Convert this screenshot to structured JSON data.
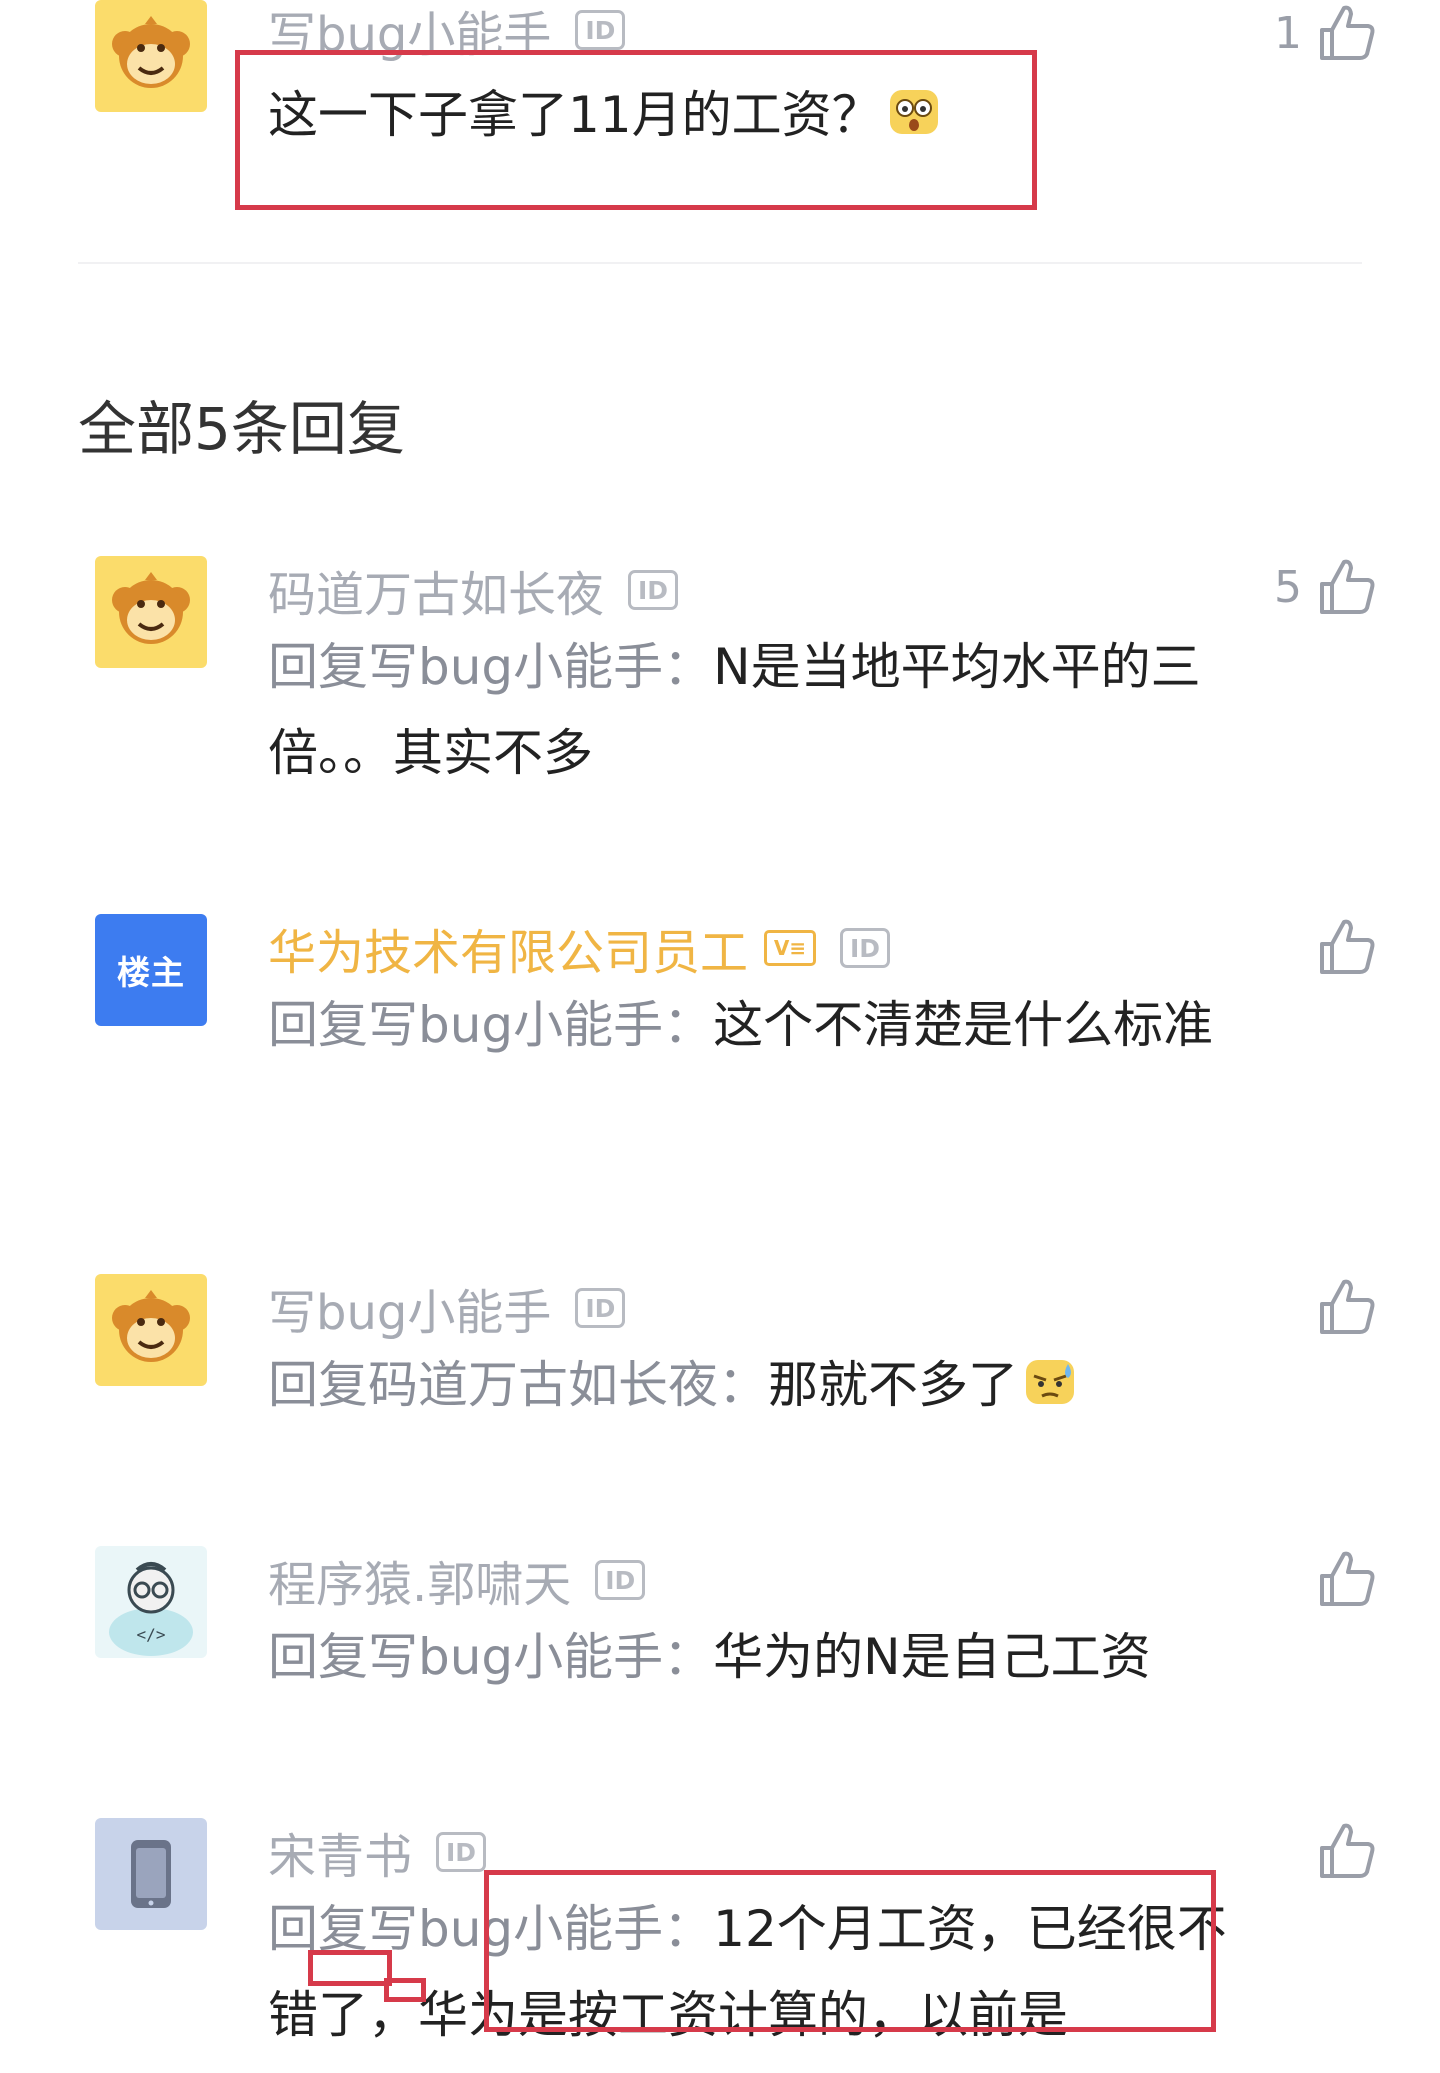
{
  "top_comment": {
    "username": "写bug小能手",
    "id_badge": "ID",
    "text": "这一下子拿了11月的工资？",
    "emoji": "shocked-face-emoji",
    "likes": "1"
  },
  "replies_header": "全部5条回复",
  "replies": [
    {
      "username": "码道万古如长夜",
      "id_badge": "ID",
      "prefix": "回复写bug小能手：",
      "text": "N是当地平均水平的三倍。。其实不多",
      "likes": "5"
    },
    {
      "avatar_label": "楼主",
      "username": "华为技术有限公司员工",
      "v_badge": "V≡",
      "id_badge": "ID",
      "prefix": "回复写bug小能手：",
      "text": "这个不清楚是什么标准",
      "likes": ""
    },
    {
      "username": "写bug小能手",
      "id_badge": "ID",
      "prefix": "回复码道万古如长夜：",
      "text": "那就不多了",
      "emoji": "sweat-face-emoji",
      "likes": ""
    },
    {
      "username": "程序猿.郭啸天",
      "id_badge": "ID",
      "prefix": "回复写bug小能手：",
      "text": "华为的N是自己工资",
      "likes": ""
    },
    {
      "username": "宋青书",
      "id_badge": "ID",
      "prefix": "回复写bug小能手：",
      "text": "12个月工资，已经很不错了，华为是按工资计算的，以前是",
      "likes": ""
    }
  ],
  "colors": {
    "username_gray": "#a7abb4",
    "op_gold": "#f0b544",
    "host_blue": "#3d7cf0",
    "annotation_red": "#d63a4a"
  }
}
